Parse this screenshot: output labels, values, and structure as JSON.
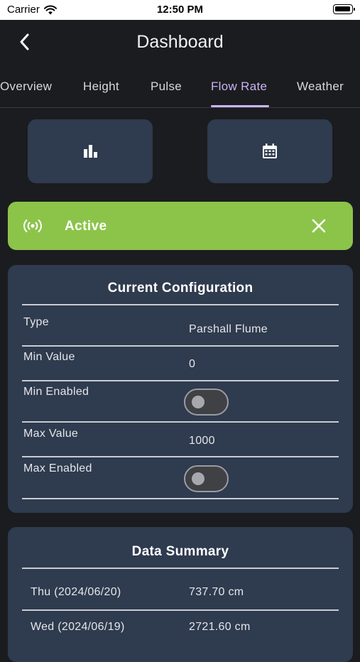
{
  "status_bar": {
    "carrier": "Carrier",
    "time": "12:50 PM"
  },
  "header": {
    "title": "Dashboard",
    "back_icon": "chevron-left-icon"
  },
  "tabs": [
    {
      "label": "Overview"
    },
    {
      "label": "Height"
    },
    {
      "label": "Pulse"
    },
    {
      "label": "Flow Rate",
      "active": true
    },
    {
      "label": "Weather"
    }
  ],
  "quick_actions": [
    {
      "icon": "bar-chart-icon"
    },
    {
      "icon": "calendar-icon"
    }
  ],
  "status_banner": {
    "label": "Active",
    "color": "#8cc44a"
  },
  "configuration": {
    "title": "Current Configuration",
    "rows": [
      {
        "label": "Type",
        "value": "Parshall Flume"
      },
      {
        "label": "Min Value",
        "value": "0"
      },
      {
        "label": "Min Enabled",
        "toggle_on": false
      },
      {
        "label": "Max Value",
        "value": "1000"
      },
      {
        "label": "Max Enabled",
        "toggle_on": false
      }
    ]
  },
  "data_summary": {
    "title": "Data Summary",
    "rows": [
      {
        "day": "Thu (2024/06/20)",
        "value": "737.70 cm"
      },
      {
        "day": "Wed (2024/06/19)",
        "value": "2721.60 cm"
      }
    ]
  },
  "colors": {
    "background": "#1b1c20",
    "card": "#2f3b4e",
    "accent": "#c8b4f2",
    "active_green": "#8cc44a"
  }
}
